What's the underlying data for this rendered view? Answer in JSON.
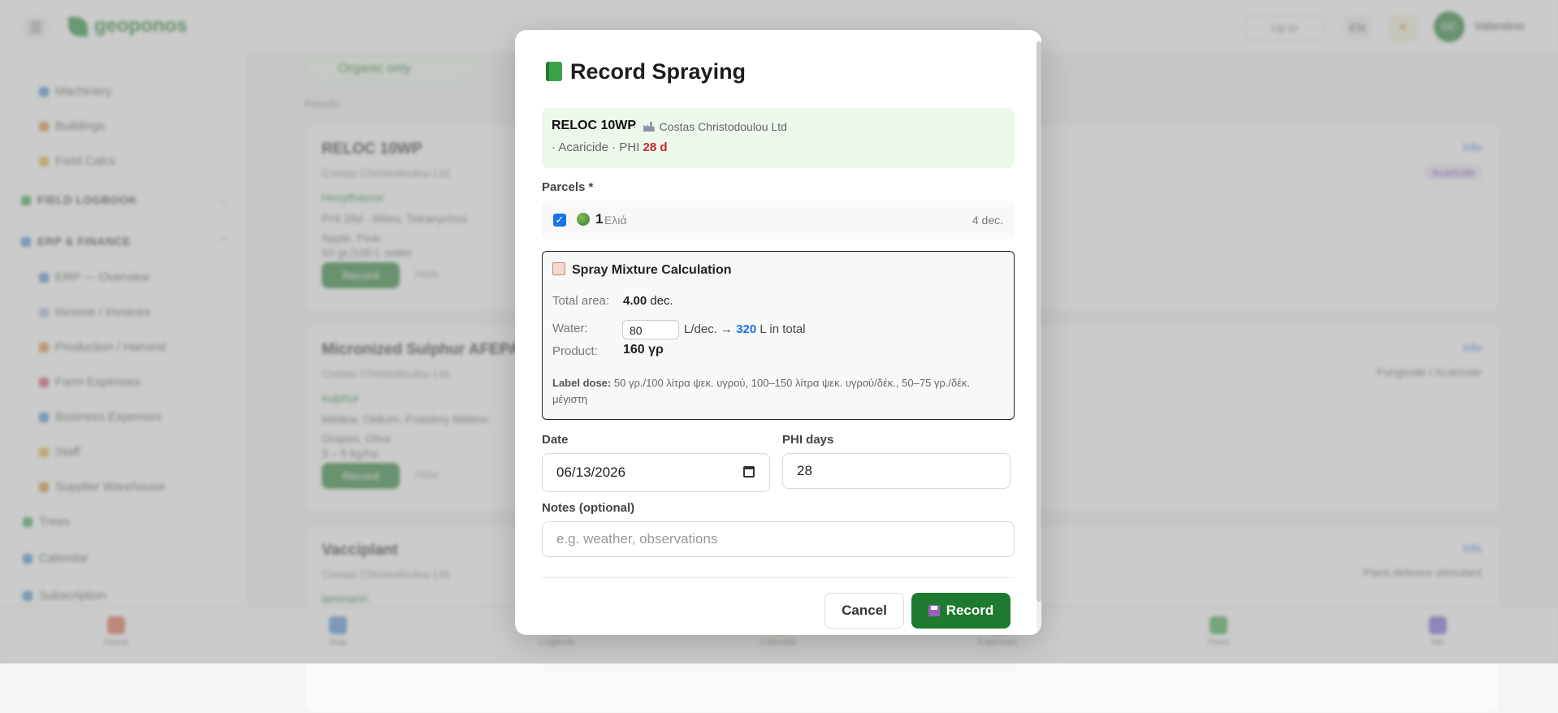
{
  "topbar": {
    "logo": "geoponos",
    "upgrade": "Up to",
    "lang": "EN",
    "avatar_initials": "GC",
    "username": "Valentino"
  },
  "sidebar": {
    "items_top": [
      "Machinery",
      "Buildings",
      "Field Calcs"
    ],
    "head_field": "FIELD LOGBOOK",
    "head_erp": "ERP & FINANCE",
    "items_erp": [
      "ERP — Overview",
      "Income / Invoices",
      "Production / Harvest",
      "Farm Expenses",
      "Business Expenses",
      "Staff",
      "Supplier Warehouse"
    ],
    "items_bottom": [
      "Trees",
      "Calendar",
      "Subscription"
    ]
  },
  "main": {
    "organic_pill": "Organic only",
    "results_label": "Results",
    "cards": [
      {
        "title": "RELOC 10WP",
        "sub": "Costas Christodoulou Ltd",
        "tag": "Hexythiazox",
        "line1": "PHI 28d · Mites, Tetranychus",
        "line2": "Apple, Pear",
        "line3": "50 gr./100 L water",
        "record": "Record",
        "hide": "Hide",
        "info": "Info",
        "badge": "Acaricide"
      },
      {
        "title": "Micronized Sulphur AFEPASA",
        "sub": "Costas Christodoulou Ltd",
        "tag": "sulphur",
        "line1": "Mildew, Oidium, Powdery Mildew",
        "line2": "Grapes, Olive",
        "line3": "3 – 5 kg/ha",
        "record": "Record",
        "hide": "Hide",
        "info": "Info",
        "role": "Fungicide / Acaricide"
      },
      {
        "title": "Vacciplant",
        "sub": "Costas Christodoulou Ltd",
        "tag": "laminarin",
        "info": "Info",
        "role": "Plant defence stimulant"
      }
    ]
  },
  "bottomnav": [
    "Home",
    "Map",
    "Logbook",
    "Calendar",
    "Expenses",
    "Trees",
    "Me"
  ],
  "modal": {
    "title": "Record Spraying",
    "product": {
      "name": "RELOC 10WP",
      "sep": "·",
      "company": "Costas Christodoulou Ltd",
      "type_prefix": "· Acaricide · PHI",
      "phi": "28 d"
    },
    "parcels_label": "Parcels *",
    "parcel": {
      "number": "1",
      "crop": "Ελιά",
      "area": "4 dec.",
      "checked": true
    },
    "calc": {
      "title": "Spray Mixture Calculation",
      "total_area_label": "Total area:",
      "total_area_value": "4.00",
      "total_area_unit": "dec.",
      "water_label": "Water:",
      "water_value": "80",
      "water_unit": "L/dec. →",
      "water_total": "320",
      "water_total_suffix": "L in total",
      "product_label": "Product:",
      "product_value": "160 γρ",
      "label_dose_prefix": "Label dose:",
      "label_dose_text": "50 γρ./100 λίτρα ψεκ. υγρού, 100–150 λίτρα ψεκ. υγρού/δέκ., 50–75 γρ./δέκ. μέγιστη"
    },
    "date_label": "Date",
    "date_value": "06/13/2026",
    "phi_days_label": "PHI days",
    "phi_days_value": "28",
    "notes_label": "Notes (optional)",
    "notes_placeholder": "e.g. weather, observations",
    "cancel": "Cancel",
    "record": "Record"
  }
}
